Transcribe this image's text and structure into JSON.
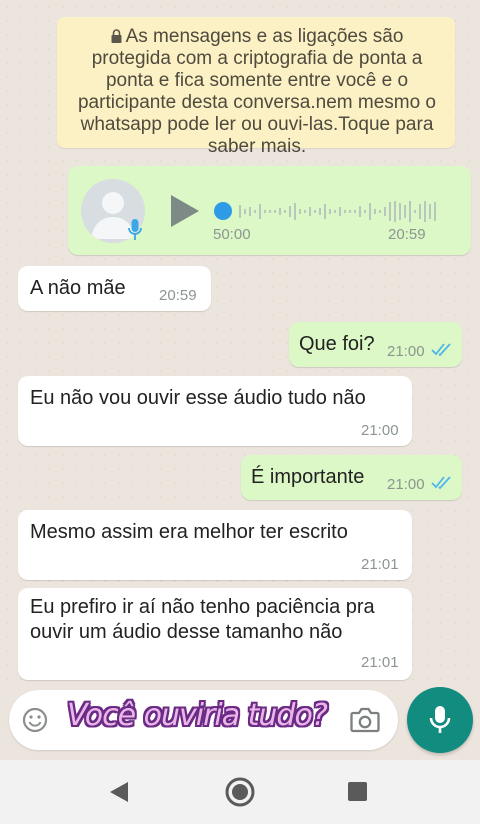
{
  "encryption_notice": "As mensagens e as ligações são protegida com a criptografia de ponta a ponta e fica somente entre você e o participante desta conversa.nem mesmo o whatsapp pode ler ou ouvi-las.Toque para saber mais.",
  "voice_message": {
    "duration": "50:00",
    "time": "20:59"
  },
  "messages": [
    {
      "direction": "in",
      "text": "A não mãe",
      "time": "20:59"
    },
    {
      "direction": "out",
      "text": "Que foi?",
      "time": "21:00",
      "status": "read"
    },
    {
      "direction": "in",
      "text": "Eu não vou ouvir esse áudio tudo não",
      "time": "21:00"
    },
    {
      "direction": "out",
      "text": "É importante",
      "time": "21:00",
      "status": "read"
    },
    {
      "direction": "in",
      "text": "Mesmo assim era melhor ter escrito",
      "time": "21:01"
    },
    {
      "direction": "in",
      "text_line1": "Eu prefiro ir aí não tenho paciência pra",
      "text_line2": "ouvir um áudio desse tamanho não",
      "time": "21:01"
    }
  ],
  "compose": {
    "overlay_caption": "Você ouviria tudo?"
  },
  "colors": {
    "outgoing_bubble": "#dcf8c6",
    "incoming_bubble": "#ffffff",
    "notice_bg": "#fbf1c4",
    "accent": "#128c7e",
    "read_ticks": "#4fb6ec"
  },
  "icons": [
    "lock-icon",
    "avatar-icon",
    "mic-icon",
    "play-icon",
    "emoji-icon",
    "camera-icon",
    "back-icon",
    "home-icon",
    "recents-icon"
  ]
}
